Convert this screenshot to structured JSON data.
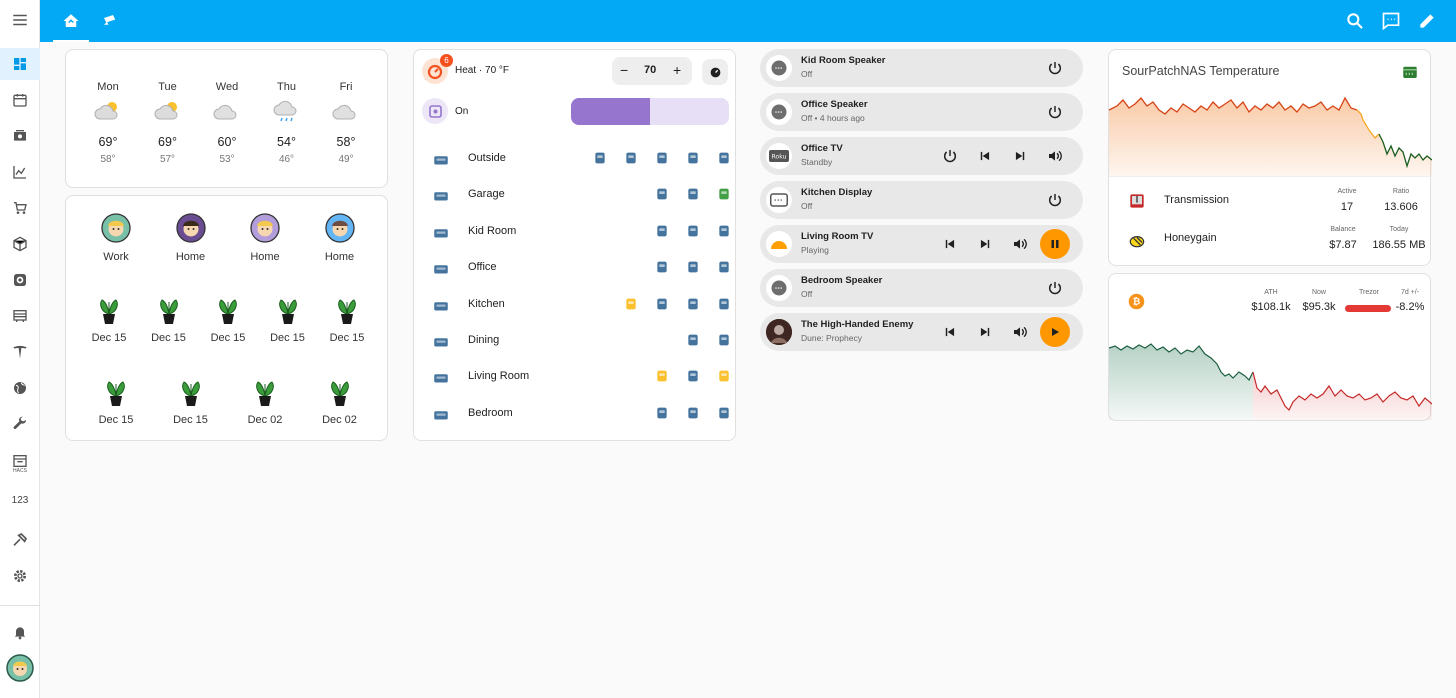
{
  "sidebar": {
    "icons": [
      "menu-icon",
      "dashboard-icon",
      "calendar-icon",
      "media-icon",
      "history-icon",
      "cart-icon",
      "box-icon",
      "camera-icon",
      "blinds-icon",
      "tesla-icon",
      "globe-icon",
      "wrench-icon",
      "hacs-icon",
      "numbers-icon",
      "hammer-icon",
      "settings-icon",
      "bell-icon",
      "avatar"
    ],
    "hacs_label": "HACS",
    "numbers_label": "123"
  },
  "weather": {
    "days": [
      {
        "day": "Mon",
        "high": "69°",
        "low": "58°",
        "icon": "partly-cloudy-icon"
      },
      {
        "day": "Tue",
        "high": "69°",
        "low": "57°",
        "icon": "partly-cloudy-icon"
      },
      {
        "day": "Wed",
        "high": "60°",
        "low": "53°",
        "icon": "cloudy-icon"
      },
      {
        "day": "Thu",
        "high": "54°",
        "low": "46°",
        "icon": "rainy-icon"
      },
      {
        "day": "Fri",
        "high": "58°",
        "low": "49°",
        "icon": "cloudy-icon"
      }
    ]
  },
  "people": [
    {
      "state": "Work"
    },
    {
      "state": "Home"
    },
    {
      "state": "Home"
    },
    {
      "state": "Home"
    }
  ],
  "plants": [
    {
      "date": "Dec 15"
    },
    {
      "date": "Dec 15"
    },
    {
      "date": "Dec 15"
    },
    {
      "date": "Dec 15"
    },
    {
      "date": "Dec 15"
    },
    {
      "date": "Dec 15"
    },
    {
      "date": "Dec 15"
    },
    {
      "date": "Dec 02"
    },
    {
      "date": "Dec 02"
    }
  ],
  "thermostat": {
    "mode": "Heat · 70 °F",
    "badge": "6",
    "setpoint": "70",
    "minus": "−",
    "plus": "+"
  },
  "light": {
    "state": "On",
    "brightness": 0.5
  },
  "rooms": [
    {
      "name": "Outside"
    },
    {
      "name": "Garage"
    },
    {
      "name": "Kid Room"
    },
    {
      "name": "Office"
    },
    {
      "name": "Kitchen"
    },
    {
      "name": "Dining"
    },
    {
      "name": "Living Room"
    },
    {
      "name": "Bedroom"
    }
  ],
  "media": [
    {
      "title": "Kid Room Speaker",
      "state": "Off"
    },
    {
      "title": "Office Speaker",
      "state": "Off • 4 hours ago"
    },
    {
      "title": "Office TV",
      "state": "Standby",
      "logo": "Roku"
    },
    {
      "title": "Kitchen Display",
      "state": "Off"
    },
    {
      "title": "Living Room TV",
      "state": "Playing"
    },
    {
      "title": "Bedroom Speaker",
      "state": "Off"
    },
    {
      "title": "The High-Handed Enemy",
      "state": "Dune: Prophecy"
    }
  ],
  "nas": {
    "title": "SourPatchNAS Temperature",
    "transmission": {
      "name": "Transmission",
      "active_label": "Active",
      "active": "17",
      "ratio_label": "Ratio",
      "ratio": "13.606"
    },
    "honeygain": {
      "name": "Honeygain",
      "balance_label": "Balance",
      "balance": "$7.87",
      "today_label": "Today",
      "today": "186.55 MB"
    }
  },
  "btc": {
    "ath_label": "ATH",
    "ath": "$108.1k",
    "now_label": "Now",
    "now": "$95.3k",
    "trezor_label": "Trezor",
    "change_label": "7d +/-",
    "change": "-8.2%"
  },
  "colors": {
    "accent": "#03a9f4",
    "orange": "#ff9800",
    "purple": "#9575cd",
    "icon_blue": "#44739e",
    "btc_red": "#d62828",
    "btc_green": "#2e7d5b"
  }
}
